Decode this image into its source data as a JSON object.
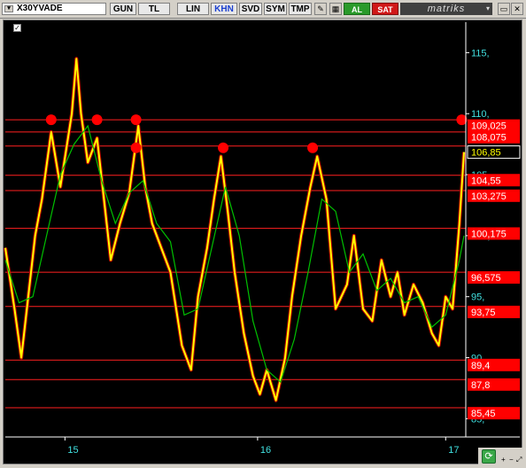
{
  "toolbar": {
    "symbol": "X30YVADE",
    "tabs": [
      "GUN",
      "TL",
      "LIN",
      "KHN",
      "SVD",
      "SYM",
      "TMP"
    ],
    "active_tab": "KHN",
    "buy_label": "AL",
    "sell_label": "SAT",
    "brand": "matriks"
  },
  "colors": {
    "background": "#000000",
    "price": "#ffff00",
    "price_outline": "#c00000",
    "moving_average": "#00c000",
    "level_line": "#ff2020",
    "level_box": "#ff0000",
    "axis_text": "#40e0e0",
    "current_price_box": "#000000"
  },
  "chart_data": {
    "type": "line",
    "instrument": "X30YVADE",
    "ylim": [
      83.5,
      117.5
    ],
    "y_ticks": [
      "115,",
      "110,",
      "105,",
      "100,",
      "95,",
      "90,",
      "85,"
    ],
    "y_tick_values": [
      115,
      110,
      105,
      100,
      95,
      90,
      85
    ],
    "x_ticks": [
      "15",
      "16",
      "17"
    ],
    "x_tick_positions": [
      0.13,
      0.55,
      0.96
    ],
    "current_price": "106,85",
    "current_price_value": 106.85,
    "levels": [
      {
        "label": "109,025",
        "value": 109.025
      },
      {
        "label": "108,075",
        "value": 108.075
      },
      {
        "label": "104,55",
        "value": 104.55
      },
      {
        "label": "103,275",
        "value": 103.275
      },
      {
        "label": "100,175",
        "value": 100.175
      },
      {
        "label": "96,575",
        "value": 96.575
      },
      {
        "label": "93,75",
        "value": 93.75
      },
      {
        "label": "89,4",
        "value": 89.4
      },
      {
        "label": "87,8",
        "value": 87.8
      },
      {
        "label": "85,45",
        "value": 85.45
      }
    ],
    "level_lines": [
      109.5,
      108.5,
      107.35,
      104.95,
      103.7,
      100.6,
      97.0,
      94.2,
      89.8,
      88.2,
      85.9
    ],
    "markers": [
      {
        "x": 0.1,
        "y": 109.5
      },
      {
        "x": 0.2,
        "y": 109.5
      },
      {
        "x": 0.285,
        "y": 109.5
      },
      {
        "x": 0.285,
        "y": 107.2
      },
      {
        "x": 0.475,
        "y": 107.2
      },
      {
        "x": 0.67,
        "y": 107.2
      },
      {
        "x": 0.995,
        "y": 109.5
      }
    ],
    "price": {
      "x": [
        0,
        0.02,
        0.035,
        0.05,
        0.065,
        0.08,
        0.1,
        0.12,
        0.145,
        0.155,
        0.165,
        0.18,
        0.2,
        0.215,
        0.23,
        0.25,
        0.27,
        0.29,
        0.305,
        0.32,
        0.34,
        0.36,
        0.385,
        0.405,
        0.42,
        0.44,
        0.455,
        0.47,
        0.485,
        0.5,
        0.52,
        0.54,
        0.555,
        0.57,
        0.59,
        0.61,
        0.625,
        0.645,
        0.665,
        0.68,
        0.7,
        0.72,
        0.745,
        0.76,
        0.78,
        0.8,
        0.82,
        0.84,
        0.855,
        0.87,
        0.89,
        0.91,
        0.93,
        0.945,
        0.96,
        0.975,
        0.99,
        1.0
      ],
      "y": [
        99.0,
        94.0,
        90.0,
        95.0,
        100.0,
        103.0,
        108.5,
        104.0,
        110.0,
        114.5,
        110.0,
        106.0,
        108.0,
        103.0,
        98.0,
        101.0,
        103.5,
        109.0,
        104.0,
        101.0,
        99.0,
        97.0,
        91.0,
        89.0,
        95.0,
        99.0,
        103.0,
        106.5,
        102.0,
        97.0,
        92.0,
        88.5,
        87.0,
        89.0,
        86.5,
        90.0,
        95.0,
        100.0,
        104.0,
        106.5,
        103.0,
        94.0,
        96.0,
        100.0,
        94.0,
        93.0,
        98.0,
        95.0,
        97.0,
        93.5,
        96.0,
        94.5,
        92.0,
        91.0,
        95.0,
        94.0,
        101.0,
        106.85
      ]
    },
    "moving_average": {
      "x": [
        0,
        0.03,
        0.06,
        0.09,
        0.12,
        0.15,
        0.18,
        0.21,
        0.24,
        0.27,
        0.3,
        0.33,
        0.36,
        0.39,
        0.42,
        0.45,
        0.48,
        0.51,
        0.54,
        0.57,
        0.6,
        0.63,
        0.66,
        0.69,
        0.72,
        0.75,
        0.78,
        0.81,
        0.84,
        0.87,
        0.9,
        0.93,
        0.96,
        0.99,
        1.0
      ],
      "y": [
        98.0,
        94.5,
        95.0,
        100.0,
        105.0,
        107.5,
        109.0,
        104.5,
        101.0,
        103.5,
        104.5,
        101.0,
        99.5,
        93.5,
        94.0,
        99.0,
        104.0,
        100.0,
        93.0,
        89.0,
        88.0,
        91.5,
        97.0,
        103.0,
        102.0,
        97.0,
        98.5,
        95.5,
        96.5,
        94.5,
        95.0,
        92.5,
        93.5,
        98.0,
        100.0
      ]
    }
  }
}
